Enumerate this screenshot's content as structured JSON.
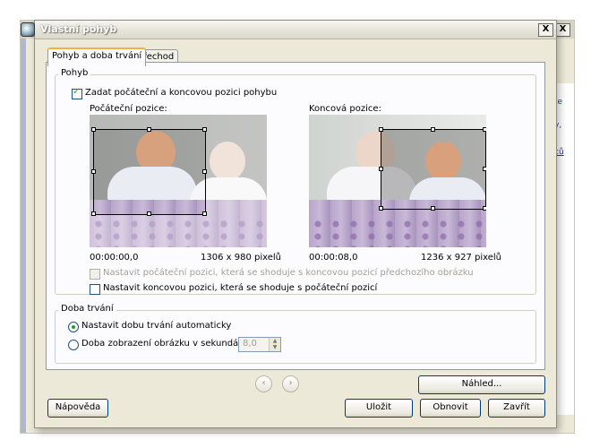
{
  "dialog": {
    "title": "Vlastní pohyb",
    "close_label": "X"
  },
  "background_window": {
    "close_label": "X",
    "side_texts": [
      "te",
      "y,",
      "ců"
    ]
  },
  "tabs": [
    {
      "label": "Pohyb a doba trvání",
      "active": true
    },
    {
      "label": "Přechod",
      "active": false
    }
  ],
  "motion": {
    "group_label": "Pohyb",
    "enable_checkbox": {
      "label": "Zadat počáteční a koncovou pozici pohybu",
      "checked": true
    },
    "start": {
      "label": "Počáteční pozice:",
      "time": "00:00:00,0",
      "size": "1306 x 980 pixelů"
    },
    "end": {
      "label": "Koncová pozice:",
      "time": "00:00:08,0",
      "size": "1236 x 927 pixelů"
    },
    "match_prev_checkbox": {
      "label": "Nastavit počáteční pozici, která se shoduje s koncovou pozicí předchozího obrázku",
      "checked": false,
      "disabled": true
    },
    "match_start_checkbox": {
      "label": "Nastavit koncovou pozici, která se shoduje s počáteční pozicí",
      "checked": false
    }
  },
  "duration": {
    "group_label": "Doba trvání",
    "auto_radio": {
      "label": "Nastavit dobu trvání automaticky",
      "checked": true
    },
    "seconds_radio": {
      "label": "Doba zobrazení obrázku v sekundách",
      "checked": false
    },
    "seconds_value": "8,0"
  },
  "navigation": {
    "prev_icon": "chevron-left-icon",
    "next_icon": "chevron-right-icon"
  },
  "buttons": {
    "preview": "Náhled...",
    "help": "Nápověda",
    "save": "Uložit",
    "restore": "Obnovit",
    "close": "Zavřít"
  },
  "colors": {
    "tab_accent": "#f0b23c",
    "dialog_bg": "#ece9d8",
    "check_green": "#21a121"
  }
}
